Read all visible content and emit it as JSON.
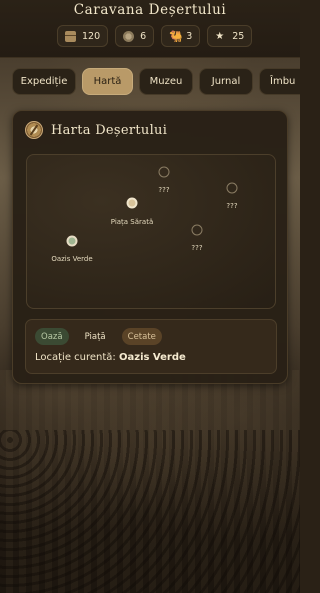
{
  "app": {
    "title": "Caravana Deșertului"
  },
  "stats": [
    {
      "icon": "chest-icon",
      "value": "120"
    },
    {
      "icon": "coins-icon",
      "value": "6"
    },
    {
      "icon": "camel-icon",
      "value": "3"
    },
    {
      "icon": "star-icon",
      "value": "25"
    }
  ],
  "tabs": [
    {
      "label": "Expediție",
      "active": false
    },
    {
      "label": "Hartă",
      "active": true
    },
    {
      "label": "Muzeu",
      "active": false
    },
    {
      "label": "Jurnal",
      "active": false
    },
    {
      "label": "Îmbu",
      "active": false
    }
  ],
  "map_card": {
    "title": "Harta Deșertului",
    "locations": [
      {
        "label": "???",
        "type": "unknown"
      },
      {
        "label": "Piața Sărată",
        "type": "market"
      },
      {
        "label": "???",
        "type": "unknown"
      },
      {
        "label": "???",
        "type": "unknown"
      },
      {
        "label": "Oazis Verde",
        "type": "oasis"
      }
    ],
    "legend": {
      "oasis": "Oază",
      "market": "Piață",
      "citadel": "Cetate"
    },
    "current_prefix": "Locație curentă:",
    "current_value": "Oazis Verde"
  },
  "colors": {
    "accent_tab": "#b99a68",
    "oasis": "#9fb592",
    "market": "#d8c39a",
    "citadel_chip": "#5a4327"
  }
}
